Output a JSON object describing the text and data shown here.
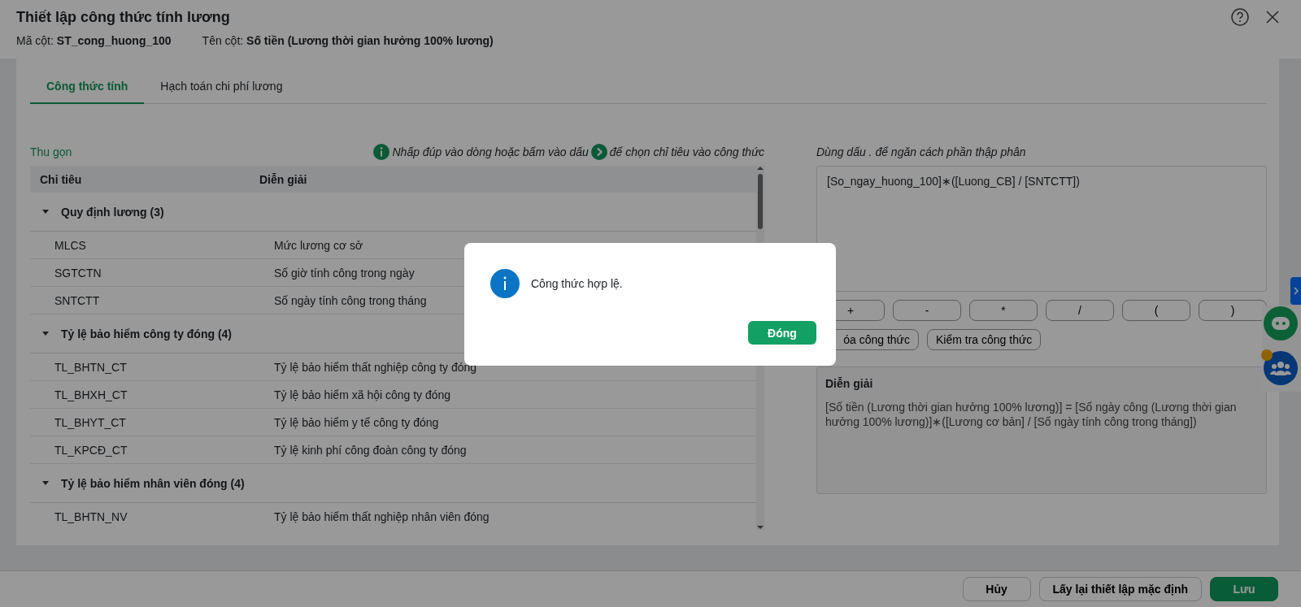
{
  "header": {
    "title": "Thiết lập công thức tính lương",
    "meta": [
      {
        "label": "Mã cột:",
        "value": "ST_cong_huong_100"
      },
      {
        "label": "Tên cột:",
        "value": "Số tiền (Lương thời gian hưởng 100% lương)"
      }
    ]
  },
  "tabs": [
    {
      "label": "Công thức tính",
      "selected": true
    },
    {
      "label": "Hạch toán chi phí lương",
      "selected": false
    }
  ],
  "left": {
    "collapse_link": "Thu gọn",
    "hint_before": "Nhấp đúp vào dòng hoặc bấm vào dấu",
    "hint_after": "để chọn chỉ tiêu vào công thức",
    "table": {
      "columns": [
        "Chỉ tiêu",
        "Diễn giải"
      ],
      "groups": [
        {
          "name": "Quy định lương (3)",
          "expanded": true,
          "children": [
            {
              "code": "MLCS",
              "desc": "Mức lương cơ sở"
            },
            {
              "code": "SGTCTN",
              "desc": "Số giờ tính công trong ngày"
            },
            {
              "code": "SNTCTT",
              "desc": "Số ngày tính công trong tháng"
            }
          ]
        },
        {
          "name": "Tỷ lệ bảo hiểm công ty đóng (4)",
          "expanded": true,
          "children": [
            {
              "code": "TL_BHTN_CT",
              "desc": "Tỷ lệ bảo hiểm thất nghiệp công ty đóng"
            },
            {
              "code": "TL_BHXH_CT",
              "desc": "Tỷ lệ bảo hiểm xã hội công ty đóng"
            },
            {
              "code": "TL_BHYT_CT",
              "desc": "Tỷ lệ bảo hiểm y tế công ty đóng"
            },
            {
              "code": "TL_KPCĐ_CT",
              "desc": "Tỷ lệ kinh phí công đoàn công ty đóng"
            }
          ]
        },
        {
          "name": "Tỷ lệ bảo hiểm nhân viên đóng (4)",
          "expanded": true,
          "children": [
            {
              "code": "TL_BHTN_NV",
              "desc": "Tỷ lệ bảo hiểm thất nghiệp nhân viên đóng"
            }
          ]
        }
      ]
    }
  },
  "right": {
    "hint": "Dùng dấu . để ngăn cách phần thập phân",
    "formula": "[So_ngay_huong_100]∗([Luong_CB] / [SNTCTT])",
    "operators": [
      "+",
      "-",
      "*",
      "/",
      "(",
      ")"
    ],
    "actions": [
      "óa công thức",
      "Kiểm tra công thức"
    ],
    "explanation": {
      "title": "Diễn giải",
      "text": "[Số tiền (Lương thời gian hưởng 100% lương)] = [Số ngày công (Lương thời gian hưởng 100% lương)]∗([Lương cơ bản] / [Số ngày tính công trong tháng])"
    }
  },
  "footer": {
    "buttons": [
      {
        "label": "Hủy",
        "kind": "secondary"
      },
      {
        "label": "Lấy lại thiết lập mặc định",
        "kind": "secondary"
      },
      {
        "label": "Lưu",
        "kind": "primary"
      }
    ]
  },
  "dialog": {
    "message": "Công thức hợp lệ.",
    "button": "Đóng"
  }
}
